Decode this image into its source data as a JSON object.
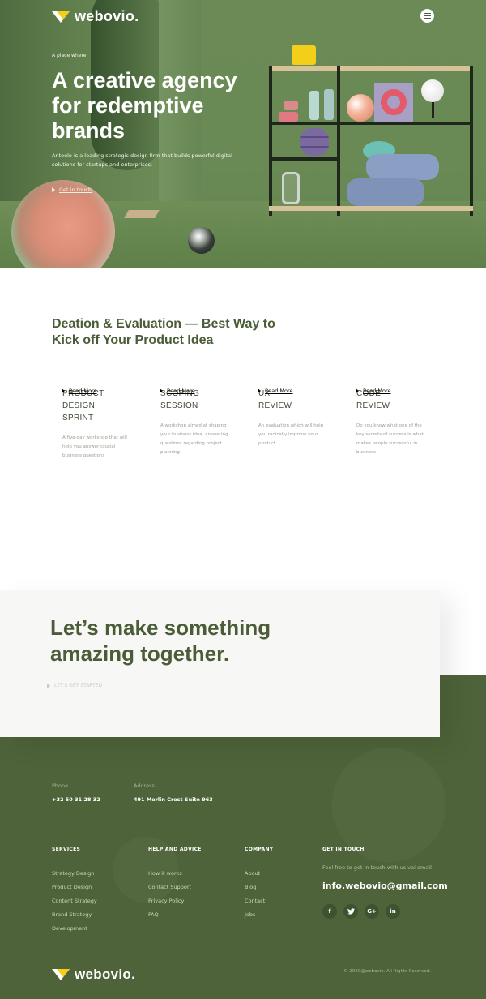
{
  "brand": {
    "name": "webovio."
  },
  "hero": {
    "kicker": "A place where",
    "title": "A creative agency for redemptive brands",
    "subtitle": "Anteelo is a leading strategic design firm that builds powerful digital solutions for startups and enterprises.",
    "cta": "Get in touch"
  },
  "services": {
    "title": "Deation & Evaluation — Best Way to Kick off Your Product Idea",
    "items": [
      {
        "title": "PRODUCT DESIGN SPRINT",
        "desc": "A five-day workshop that will help you answer crucial business questions",
        "more": "Read More"
      },
      {
        "title": "SCOPING SESSION",
        "desc": "A workshop aimed at shaping your business idea, answering questions regarding project planning",
        "more": "Read More"
      },
      {
        "title": "UX REVIEW",
        "desc": "An evaluation which will help you radically improve your product.",
        "more": "Read More"
      },
      {
        "title": "CODE REVIEW",
        "desc": "Do you know what one of the key secrets of success is what makes people successful in business",
        "more": "Read More"
      }
    ]
  },
  "cta_block": {
    "title": "Let’s make something amazing together.",
    "link": "LET'S GET STARTED"
  },
  "footer": {
    "phone_label": "Phone",
    "phone": "+32 50 31 28 32",
    "address_label": "Address",
    "address": "491 Merlin Crest Suite 963",
    "columns": [
      {
        "head": "SERVICES",
        "items": [
          "Strategy Design",
          "Product Design",
          "Content Strategy",
          "Brand Strategy",
          "Development"
        ]
      },
      {
        "head": "HELP AND ADVICE",
        "items": [
          "How it works",
          "Contact Support",
          "Privacy Policy",
          "FAQ"
        ]
      },
      {
        "head": "COMPANY",
        "items": [
          "About",
          "Blog",
          "Contact",
          "Jobs"
        ]
      }
    ],
    "contact": {
      "head": "GET IN TOUCH",
      "note": "Feel free to get in touch with us vai email",
      "email": "info.webovio@gmail.com",
      "socials": [
        {
          "icon": "facebook-icon",
          "glyph": "f"
        },
        {
          "icon": "twitter-icon",
          "glyph": "t"
        },
        {
          "icon": "google-plus-icon",
          "glyph": "G+"
        },
        {
          "icon": "linkedin-icon",
          "glyph": "in"
        }
      ]
    },
    "copyright": "© 2020@webovio. All Rights Reserved."
  },
  "colors": {
    "brand_green": "#4e6339",
    "accent_yellow": "#f4cf1a",
    "hero_green": "#6a8a55"
  }
}
